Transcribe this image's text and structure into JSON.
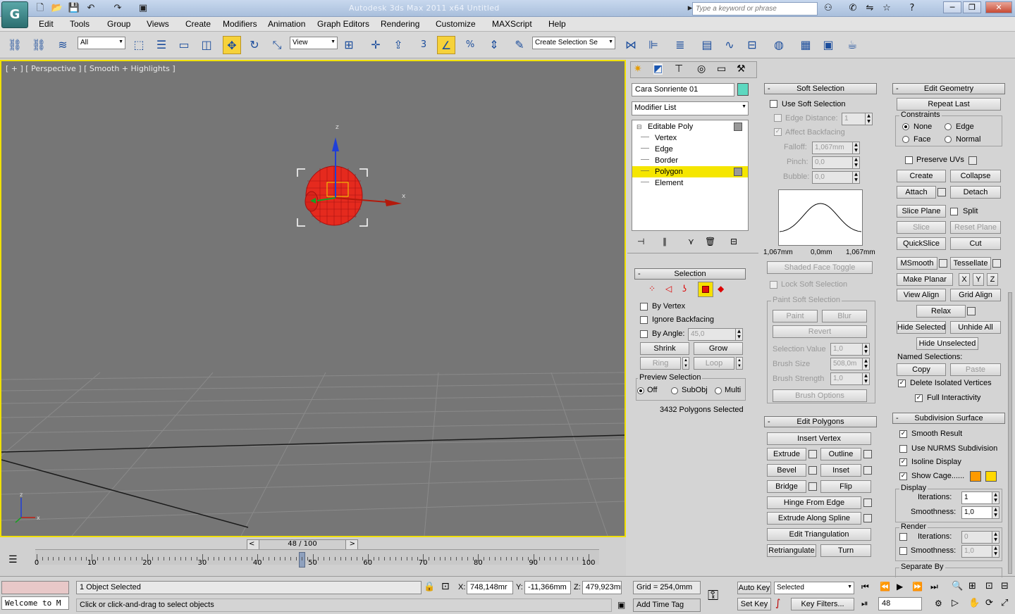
{
  "app": {
    "title": "Autodesk 3ds Max  2011 x64      Untitled",
    "search_placeholder": "Type a keyword or phrase",
    "logo": "3ds-max-logo"
  },
  "menu": [
    "Edit",
    "Tools",
    "Group",
    "Views",
    "Create",
    "Modifiers",
    "Animation",
    "Graph Editors",
    "Rendering",
    "Customize",
    "MAXScript",
    "Help"
  ],
  "toolbar": {
    "filter_value": "All",
    "refcoord_value": "View",
    "named_sel_value": "Create Selection Se",
    "snap_label": "3"
  },
  "viewport": {
    "label": "[ + ] [ Perspective ] [ Smooth + Highlights ]",
    "axis_x": "x",
    "axis_z": "z",
    "ground_axis_x": "x",
    "ground_axis_z": "z"
  },
  "timeline": {
    "frame_label": "48 / 100",
    "ticks": [
      "0",
      "10",
      "20",
      "30",
      "40",
      "50",
      "60",
      "70",
      "80",
      "90",
      "100"
    ],
    "current_frame": 48,
    "max_frame": 100
  },
  "status": {
    "selected": "1 Object Selected",
    "prompt": "Click or click-and-drag to select objects",
    "listener": "Welcome to M",
    "x_label": "X:",
    "x_value": "748,148mr",
    "y_label": "Y:",
    "y_value": "-11,366mm",
    "z_label": "Z:",
    "z_value": "479,923mr",
    "grid": "Grid = 254,0mm",
    "add_time_tag": "Add Time Tag",
    "auto_key": "Auto Key",
    "set_key": "Set Key",
    "selected_dd": "Selected",
    "key_filters": "Key Filters...",
    "frame_value": "48"
  },
  "modify": {
    "object_name": "Cara Sonriente 01",
    "object_color": "#5dd8c0",
    "modifier_list": "Modifier List",
    "stack": [
      {
        "label": "Editable Poly",
        "level": 0
      },
      {
        "label": "Vertex",
        "level": 1
      },
      {
        "label": "Edge",
        "level": 1
      },
      {
        "label": "Border",
        "level": 1
      },
      {
        "label": "Polygon",
        "level": 1,
        "active": true
      },
      {
        "label": "Element",
        "level": 1
      }
    ]
  },
  "selection": {
    "title": "Selection",
    "by_vertex": "By Vertex",
    "ignore_backfacing": "Ignore Backfacing",
    "by_angle": "By Angle:",
    "angle_value": "45,0",
    "shrink": "Shrink",
    "grow": "Grow",
    "ring": "Ring",
    "loop": "Loop",
    "preview_title": "Preview Selection",
    "preview_off": "Off",
    "preview_subobj": "SubObj",
    "preview_multi": "Multi",
    "count": "3432 Polygons Selected"
  },
  "soft": {
    "title": "Soft Selection",
    "use_soft": "Use Soft Selection",
    "edge_distance": "Edge Distance:",
    "edge_distance_value": "1",
    "affect_backfacing": "Affect Backfacing",
    "falloff": "Falloff:",
    "falloff_value": "1,067mm",
    "pinch": "Pinch:",
    "pinch_value": "0,0",
    "bubble": "Bubble:",
    "bubble_value": "0,0",
    "curve_left": "1,067mm",
    "curve_mid": "0,0mm",
    "curve_right": "1,067mm",
    "shaded_face_toggle": "Shaded Face Toggle",
    "lock_soft": "Lock Soft Selection",
    "paint_title": "Paint Soft Selection",
    "paint": "Paint",
    "blur": "Blur",
    "revert": "Revert",
    "sel_value": "Selection Value",
    "sel_value_v": "1,0",
    "brush_size": "Brush Size",
    "brush_size_v": "508,0m",
    "brush_strength": "Brush Strength",
    "brush_strength_v": "1,0",
    "brush_options": "Brush Options"
  },
  "edit_polygons": {
    "title": "Edit Polygons",
    "insert_vertex": "Insert Vertex",
    "extrude": "Extrude",
    "outline": "Outline",
    "bevel": "Bevel",
    "inset": "Inset",
    "bridge": "Bridge",
    "flip": "Flip",
    "hinge": "Hinge From Edge",
    "extrude_spline": "Extrude Along Spline",
    "edit_tri": "Edit Triangulation",
    "retriangulate": "Retriangulate",
    "turn": "Turn"
  },
  "edit_geometry": {
    "title": "Edit Geometry",
    "repeat_last": "Repeat Last",
    "constraints": "Constraints",
    "none": "None",
    "edge": "Edge",
    "face": "Face",
    "normal": "Normal",
    "preserve_uvs": "Preserve UVs",
    "create": "Create",
    "collapse": "Collapse",
    "attach": "Attach",
    "detach": "Detach",
    "slice_plane": "Slice Plane",
    "split": "Split",
    "slice": "Slice",
    "reset_plane": "Reset Plane",
    "quickslice": "QuickSlice",
    "cut": "Cut",
    "msmooth": "MSmooth",
    "tessellate": "Tessellate",
    "make_planar": "Make Planar",
    "x": "X",
    "y": "Y",
    "z": "Z",
    "view_align": "View Align",
    "grid_align": "Grid Align",
    "relax": "Relax",
    "hide_selected": "Hide Selected",
    "unhide_all": "Unhide All",
    "hide_unselected": "Hide Unselected",
    "named_selections": "Named Selections:",
    "copy": "Copy",
    "paste": "Paste",
    "delete_isolated": "Delete Isolated Vertices",
    "full_interactivity": "Full Interactivity"
  },
  "subdivision": {
    "title": "Subdivision Surface",
    "smooth_result": "Smooth Result",
    "use_nurms": "Use NURMS Subdivision",
    "isoline": "Isoline Display",
    "show_cage": "Show Cage......",
    "cage_color1": "#ff9a00",
    "cage_color2": "#ffd800",
    "display": "Display",
    "iterations": "Iterations:",
    "iterations_v": "1",
    "smoothness": "Smoothness:",
    "smoothness_v": "1,0",
    "render": "Render",
    "r_iterations_v": "0",
    "r_smoothness_v": "1,0",
    "separate_by": "Separate By"
  },
  "colors": {
    "viewport_border": "#f0e000",
    "mesh": "#e8201c",
    "active_stack": "#f5e600",
    "active_tool": "#f6d23a"
  }
}
